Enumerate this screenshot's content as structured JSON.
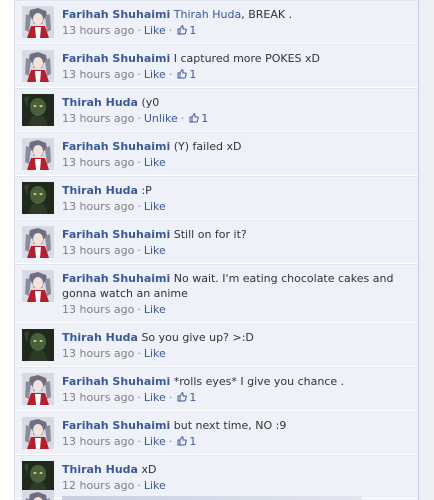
{
  "colors": {
    "link": "#3b5998",
    "meta": "#808080",
    "background": "#eef1f7"
  },
  "comments": [
    {
      "author": "Farihah Shuhaimi",
      "avatar": "anime-avatar",
      "text": "Thirah Huda, BREAK .",
      "text_link": "Thirah Huda",
      "text_rest": ", BREAK .",
      "time": "13 hours ago",
      "like_label": "Like",
      "likes": "1"
    },
    {
      "author": "Farihah Shuhaimi",
      "avatar": "anime-avatar",
      "text": "I captured more POKES xD",
      "time": "13 hours ago",
      "like_label": "Like",
      "likes": "1"
    },
    {
      "author": "Thirah Huda",
      "avatar": "dark-avatar",
      "text": "(y0",
      "time": "13 hours ago",
      "like_label": "Unlike",
      "likes": "1"
    },
    {
      "author": "Farihah Shuhaimi",
      "avatar": "anime-avatar",
      "text": "(Y) failed xD",
      "time": "13 hours ago",
      "like_label": "Like",
      "likes": ""
    },
    {
      "author": "Thirah Huda",
      "avatar": "dark-avatar",
      "text": ":P",
      "time": "13 hours ago",
      "like_label": "Like",
      "likes": ""
    },
    {
      "author": "Farihah Shuhaimi",
      "avatar": "anime-avatar",
      "text": "Still on for it?",
      "time": "13 hours ago",
      "like_label": "Like",
      "likes": ""
    },
    {
      "author": "Farihah Shuhaimi",
      "avatar": "anime-avatar",
      "text": "No wait. I'm eating chocolate cakes and gonna watch an anime",
      "time": "13 hours ago",
      "like_label": "Like",
      "likes": ""
    },
    {
      "author": "Thirah Huda",
      "avatar": "dark-avatar",
      "text": "So you give up? >:D",
      "time": "13 hours ago",
      "like_label": "Like",
      "likes": ""
    },
    {
      "author": "Farihah Shuhaimi",
      "avatar": "anime-avatar",
      "text": "*rolls eyes* I give you chance .",
      "time": "13 hours ago",
      "like_label": "Like",
      "likes": "1"
    },
    {
      "author": "Farihah Shuhaimi",
      "avatar": "anime-avatar",
      "text": "but next time, NO :9",
      "time": "13 hours ago",
      "like_label": "Like",
      "likes": "1"
    },
    {
      "author": "Thirah Huda",
      "avatar": "dark-avatar",
      "text": "xD",
      "time": "12 hours ago",
      "like_label": "Like",
      "likes": ""
    }
  ],
  "separator": "·"
}
